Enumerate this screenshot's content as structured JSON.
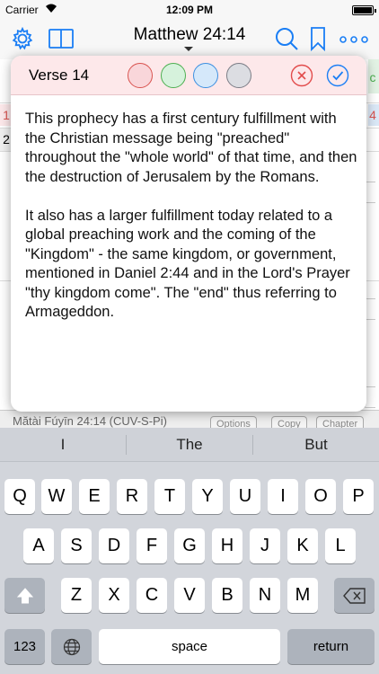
{
  "status_bar": {
    "carrier": "Carrier",
    "time": "12:09 PM"
  },
  "nav": {
    "title": "Matthew 24:14"
  },
  "background": {
    "left_numbers": [
      "1",
      "2"
    ],
    "right_markers": [
      "c",
      "4"
    ],
    "footer_label": "Mătài Fúyīn 24:14 (CUV-S-Pi)",
    "footer_buttons": [
      "Options",
      "Copy",
      "Chapter"
    ]
  },
  "popup": {
    "verse_label": "Verse 14",
    "swatches": [
      {
        "name": "red",
        "fill": "#f9d6da",
        "stroke": "#d9534f"
      },
      {
        "name": "green",
        "fill": "#d6f2dc",
        "stroke": "#4caf50"
      },
      {
        "name": "blue",
        "fill": "#d5e8fa",
        "stroke": "#3b8fe0"
      },
      {
        "name": "gray",
        "fill": "#dcdde2",
        "stroke": "#7a7c85"
      }
    ],
    "paragraphs": [
      "This prophecy has a first century fulfillment with the Christian message being \"preached\" throughout the \"whole world\" of that time, and then the destruction of Jerusalem by the Romans.",
      "It also has a larger fulfillment today related to a global preaching work and the coming of the \"Kingdom\" - the same kingdom, or government, mentioned in Daniel 2:44 and in the Lord's Prayer \"thy kingdom come\". The \"end\" thus referring to Armageddon."
    ]
  },
  "keyboard": {
    "suggestions": [
      "I",
      "The",
      "But"
    ],
    "row1": [
      "Q",
      "W",
      "E",
      "R",
      "T",
      "Y",
      "U",
      "I",
      "O",
      "P"
    ],
    "row2": [
      "A",
      "S",
      "D",
      "F",
      "G",
      "H",
      "J",
      "K",
      "L"
    ],
    "row3": [
      "Z",
      "X",
      "C",
      "V",
      "B",
      "N",
      "M"
    ],
    "numbers_key": "123",
    "space_key": "space",
    "return_key": "return"
  },
  "colors": {
    "accent": "#1a7ef5",
    "close_red": "#e24b4b",
    "header_pink": "#fde8ea"
  }
}
